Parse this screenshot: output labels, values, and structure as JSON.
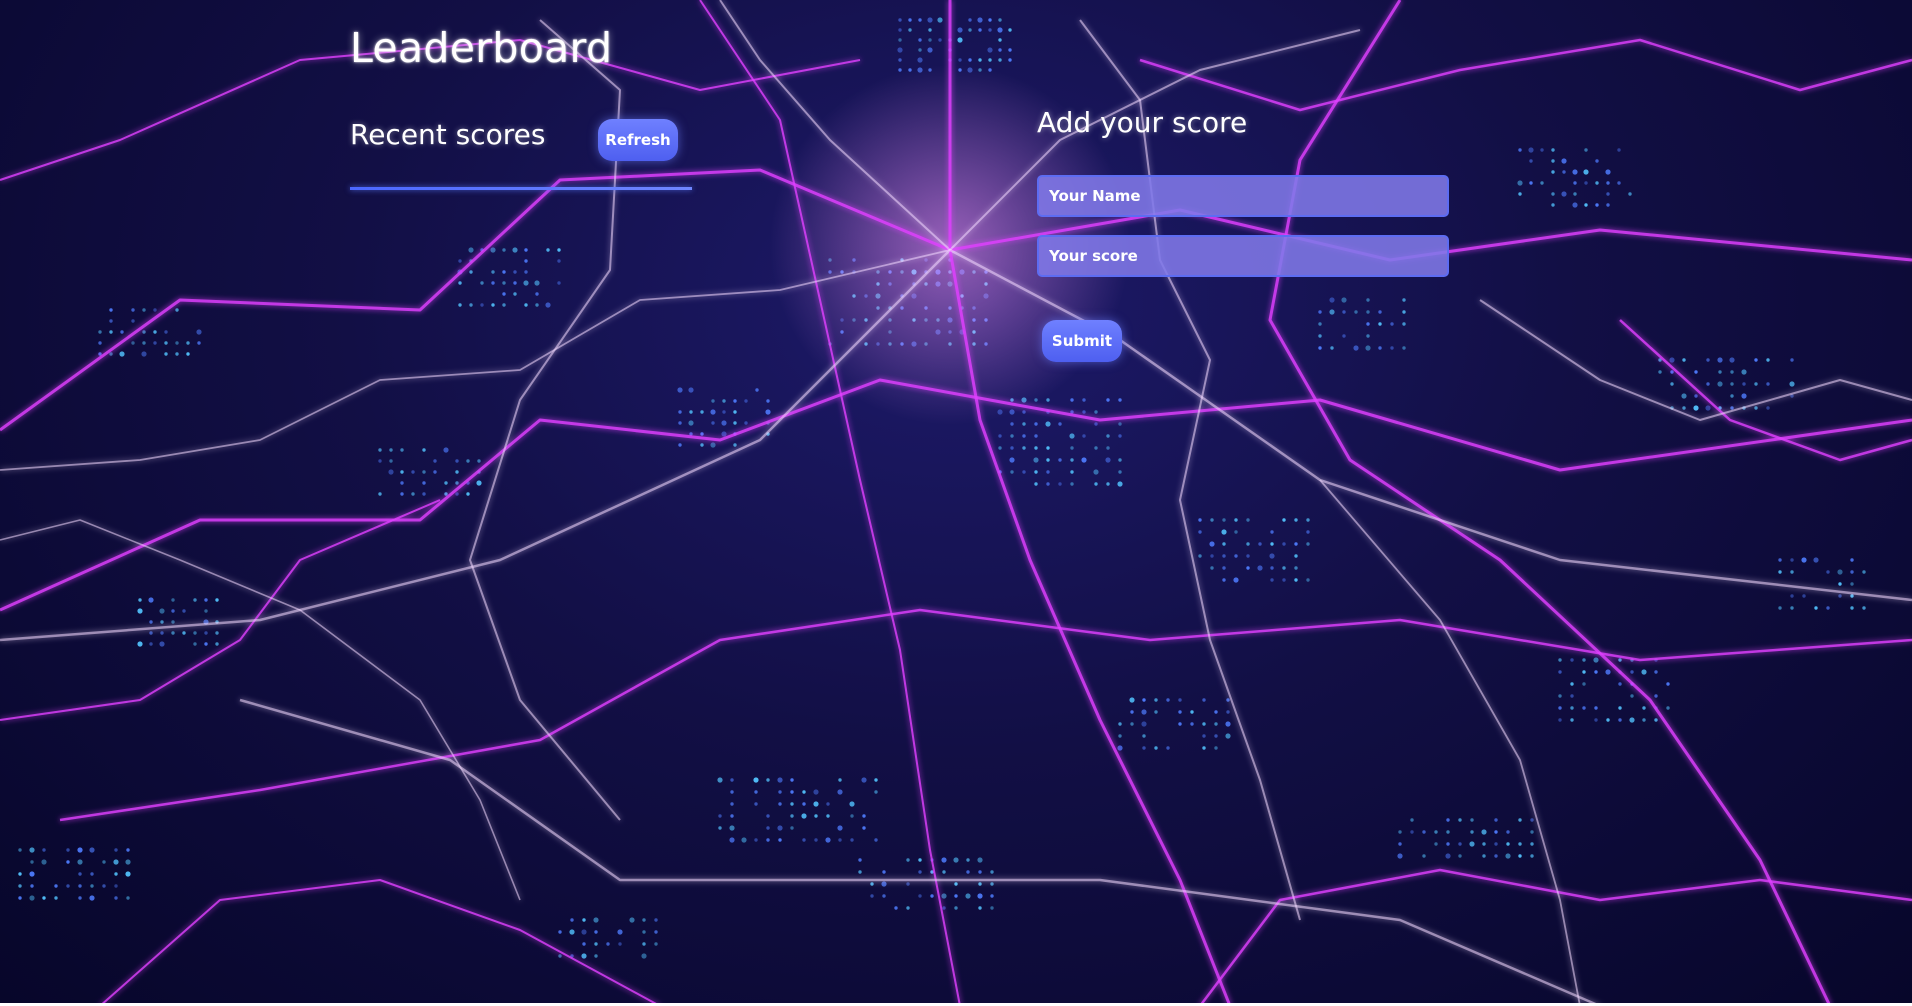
{
  "header": {
    "title": "Leaderboard"
  },
  "scores_panel": {
    "heading": "Recent scores",
    "refresh_label": "Refresh"
  },
  "add_score_panel": {
    "heading": "Add your score",
    "name_placeholder": "Your Name",
    "score_placeholder": "Your score",
    "submit_label": "Submit"
  },
  "background": {
    "icon": "circuit-grid-background",
    "colors": {
      "base": "#0b0a2e",
      "magenta_line": "#e040ff",
      "white_line": "#f3d8ff",
      "dot_blue": "#4f7dff",
      "dot_cyan": "#53c4ff"
    }
  },
  "colors": {
    "accent": "#5d6cf2",
    "button": "#6f80ff",
    "field": "#8179e8",
    "text": "#ffffff"
  }
}
